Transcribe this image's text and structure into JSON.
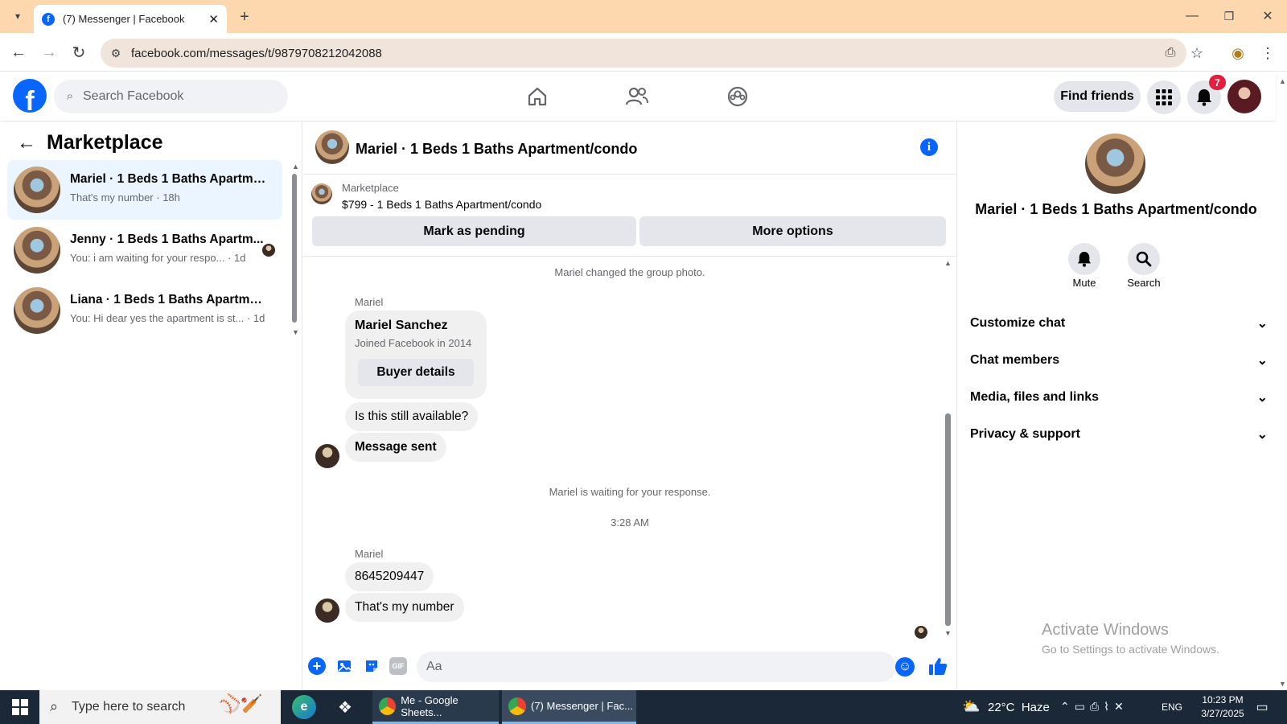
{
  "browser": {
    "tab_title": "(7) Messenger | Facebook",
    "url": "facebook.com/messages/t/9879708212042088"
  },
  "header": {
    "search_placeholder": "Search Facebook",
    "find_friends": "Find friends",
    "notification_count": "7"
  },
  "left": {
    "title": "Marketplace",
    "conversations": [
      {
        "title": "Mariel · 1 Beds 1 Baths Apartme...",
        "preview": "That's my number",
        "time": "18h"
      },
      {
        "title": "Jenny · 1 Beds 1 Baths Apartm...",
        "preview": "You: i am waiting for your respo...",
        "time": "1d"
      },
      {
        "title": "Liana · 1 Beds 1 Baths Apartment...",
        "preview": "You: Hi dear yes the apartment is st...",
        "time": "1d"
      }
    ]
  },
  "chat": {
    "title": "Mariel · 1 Beds 1 Baths Apartment/condo",
    "listing_source": "Marketplace",
    "listing": "$799 - 1 Beds 1 Baths Apartment/condo",
    "mark_pending": "Mark as pending",
    "more_options": "More options",
    "sys_group_photo": "Mariel changed the group photo.",
    "sender1": "Mariel",
    "card_name": "Mariel Sanchez",
    "card_joined": "Joined Facebook in 2014",
    "buyer_details": "Buyer details",
    "msg1": "Is this still available?",
    "msg2": "Message sent",
    "sys_waiting": "Mariel is waiting for your response.",
    "time": "3:28 AM",
    "sender2": "Mariel",
    "msg3": "8645209447",
    "msg4": "That's my number",
    "composer_placeholder": "Aa"
  },
  "right": {
    "name": "Mariel · 1 Beds 1 Baths Apartment/condo",
    "mute": "Mute",
    "search": "Search",
    "sections": [
      "Customize chat",
      "Chat members",
      "Media, files and links",
      "Privacy & support"
    ]
  },
  "watermark": {
    "title": "Activate Windows",
    "sub": "Go to Settings to activate Windows."
  },
  "taskbar": {
    "search": "Type here to search",
    "app1": "Me - Google Sheets...",
    "app2": "(7) Messenger | Fac...",
    "weather": "22°C  Haze",
    "lang": "ENG",
    "clock_time": "10:23 PM",
    "clock_date": "3/27/2025"
  }
}
